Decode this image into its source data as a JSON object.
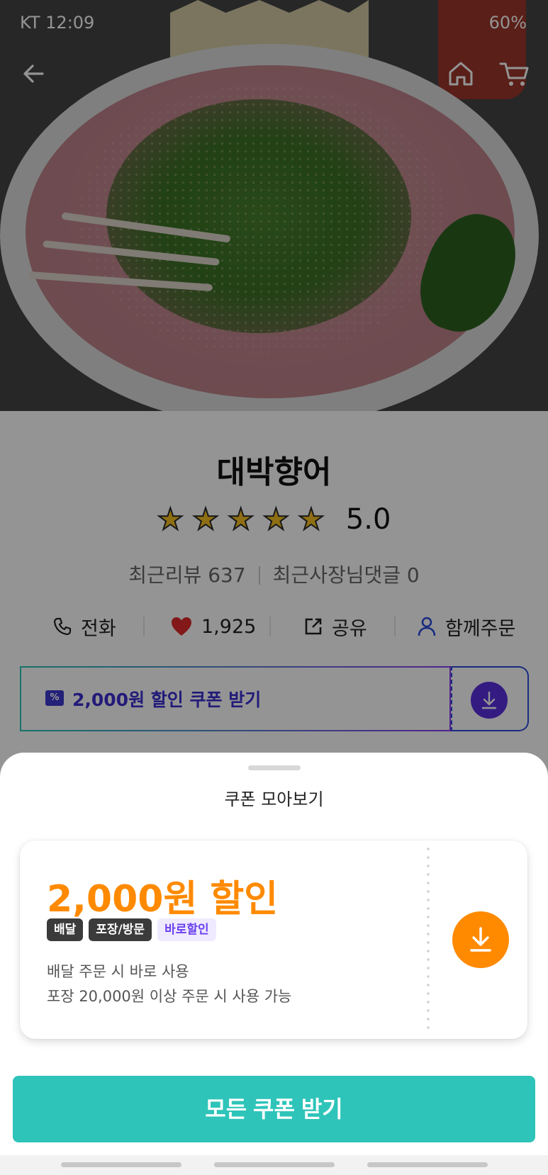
{
  "status_bar": {
    "carrier_time": "KT 12:09",
    "battery": "60%"
  },
  "nav": {
    "back_icon": "back-arrow-icon",
    "home_icon": "home-icon",
    "cart_icon": "cart-icon"
  },
  "store": {
    "name": "대박향어",
    "rating": "5.0",
    "stars": 5,
    "recent_reviews": "최근리뷰 637",
    "owner_replies": "최근사장님댓글 0"
  },
  "actions": {
    "call": "전화",
    "likes": "1,925",
    "share": "공유",
    "group_order": "함께주문"
  },
  "coupon_bar": {
    "label": "2,000원 할인 쿠폰 받기",
    "icon": "%"
  },
  "sheet": {
    "title": "쿠폰 모아보기",
    "coupon": {
      "amount": "2,000원 할인",
      "tags": [
        "배달",
        "포장/방문",
        "바로할인"
      ],
      "desc_line1": "배달 주문 시 바로 사용",
      "desc_line2": "포장 20,000원 이상 주문 시 사용 가능"
    },
    "all_button": "모든 쿠폰 받기"
  },
  "colors": {
    "accent_teal": "#2ec4b9",
    "coupon_orange": "#ff8a00",
    "coupon_purple": "#3b2fd0",
    "heart_red": "#e02a2a"
  }
}
